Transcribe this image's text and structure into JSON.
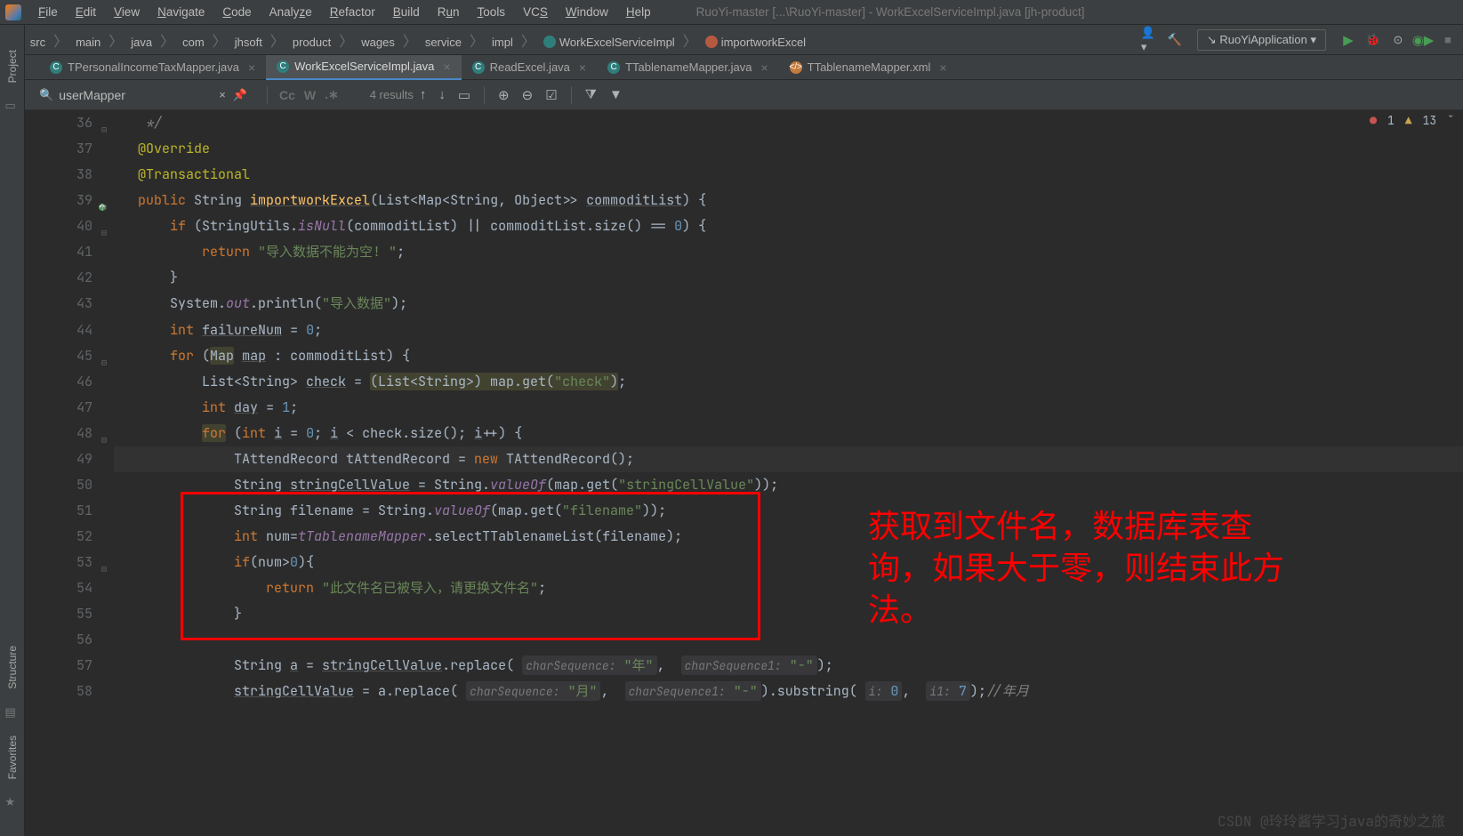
{
  "window_title": "RuoYi-master [...\\RuoYi-master] - WorkExcelServiceImpl.java [jh-product]",
  "menu": {
    "file": "File",
    "edit": "Edit",
    "view": "View",
    "navigate": "Navigate",
    "code": "Code",
    "analyze": "Analyze",
    "refactor": "Refactor",
    "build": "Build",
    "run": "Run",
    "tools": "Tools",
    "vcs": "VCS",
    "window": "Window",
    "help": "Help"
  },
  "breadcrumb": [
    "src",
    "main",
    "java",
    "com",
    "jhsoft",
    "product",
    "wages",
    "service",
    "impl",
    "WorkExcelServiceImpl",
    "importworkExcel"
  ],
  "run_config": "RuoYiApplication",
  "tabs": [
    {
      "icon": "c",
      "label": "TPersonalIncomeTaxMapper.java",
      "active": false
    },
    {
      "icon": "c",
      "label": "WorkExcelServiceImpl.java",
      "active": true
    },
    {
      "icon": "c",
      "label": "ReadExcel.java",
      "active": false
    },
    {
      "icon": "c",
      "label": "TTablenameMapper.java",
      "active": false
    },
    {
      "icon": "x",
      "label": "TTablenameMapper.xml",
      "active": false
    }
  ],
  "find": {
    "query": "userMapper",
    "results": "4 results",
    "toggles": {
      "cc": "Cc",
      "w": "W"
    }
  },
  "left_tools": {
    "project": "Project",
    "structure": "Structure",
    "favorites": "Favorites"
  },
  "inspection": {
    "errors": "1",
    "warnings": "13"
  },
  "lines": {
    "start": 36,
    "rows": [
      {
        "n": 36,
        "html": "    <span class='cmt'>*/</span>"
      },
      {
        "n": 37,
        "html": "   <span class='anno'>@Override</span>"
      },
      {
        "n": 38,
        "html": "   <span class='anno'>@Transactional</span>"
      },
      {
        "n": 39,
        "html": "   <span class='kw'>public</span> String <span class='mth under'>importworkExcel</span>(List&lt;Map&lt;String, Object&gt;&gt; <span class='under'>commoditList</span>) {"
      },
      {
        "n": 40,
        "html": "       <span class='kw'>if</span> (StringUtils.<span class='fld'>isNull</span>(commoditList) || commoditList.size() == <span class='num'>0</span>) {"
      },
      {
        "n": 41,
        "html": "           <span class='kw'>return</span> <span class='str'>\"导入数据不能为空! \"</span>;"
      },
      {
        "n": 42,
        "html": "       }"
      },
      {
        "n": 43,
        "html": "       System.<span class='fld'>out</span>.println(<span class='str'>\"导入数据\"</span>);"
      },
      {
        "n": 44,
        "html": "       <span class='kw'>int</span> <span class='under'>failureNum</span> = <span class='num'>0</span>;"
      },
      {
        "n": 45,
        "html": "       <span class='kw'>for</span> (<span class='warn-bg'>Map</span> <span class='under'>map</span> : commoditList) {"
      },
      {
        "n": 46,
        "html": "           List&lt;String&gt; <span class='under'>check</span> = <span class='warn-bg'>(List&lt;String&gt;) map.get(<span class='str'>\"check\"</span>)</span>;"
      },
      {
        "n": 47,
        "html": "           <span class='kw'>int</span> <span class='under'>day</span> = <span class='num'>1</span>;"
      },
      {
        "n": 48,
        "html": "           <span class='kw warn-bg'>for</span> (<span class='kw'>int</span> <span class='under'>i</span> = <span class='num'>0</span>; <span class='under'>i</span> &lt; check.size(); <span class='under'>i</span>++) {"
      },
      {
        "n": 49,
        "html": "               TAttendRecord tAttendRecord = <span class='kw'>new</span> TAttendRecord();",
        "current": true
      },
      {
        "n": 50,
        "html": "               String <span class='under'>stringCellValue</span> = String.<span class='fld'>valueOf</span>(map.get(<span class='str'>\"stringCellValue\"</span>));"
      },
      {
        "n": 51,
        "html": "               String filename = String.<span class='fld'>valueOf</span>(map.get(<span class='str'>\"filename\"</span>));"
      },
      {
        "n": 52,
        "html": "               <span class='kw'>int</span> num=<span class='fld'>tTablenameMapper</span>.selectTTablenameList(filename);"
      },
      {
        "n": 53,
        "html": "               <span class='kw'>if</span>(num&gt;<span class='num'>0</span>){"
      },
      {
        "n": 54,
        "html": "                   <span class='kw'>return</span> <span class='str'>\"此文件名已被导入，请更换文件名\"</span>;"
      },
      {
        "n": 55,
        "html": "               }"
      },
      {
        "n": 56,
        "html": ""
      },
      {
        "n": 57,
        "html": "               String <span class='under'>a</span> = <span class='under'>stringCellValue</span>.replace( <span class='hint-bg'><span class='hint-t'>charSequence:</span> <span class='str'>\"年\"</span></span>,  <span class='hint-bg'><span class='hint-t'>charSequence1:</span> <span class='str'>\"-\"</span></span>);"
      },
      {
        "n": 58,
        "html": "               <span class='under'>stringCellValue</span> = a.replace( <span class='hint-bg'><span class='hint-t'>charSequence:</span> <span class='str'>\"月\"</span></span>,  <span class='hint-bg'><span class='hint-t'>charSequence1:</span> <span class='str'>\"-\"</span></span>).substring( <span class='hint-bg'><span class='hint-t'>i:</span> <span class='num'>0</span></span>,  <span class='hint-bg'><span class='hint-t'>i1:</span> <span class='num'>7</span></span>);<span class='cmt'>//年月</span>"
      }
    ]
  },
  "annotation_text": "获取到文件名，数据库表查询，如果大于零，则结束此方法。",
  "watermark": "CSDN @玲玲酱学习java的奇妙之旅"
}
